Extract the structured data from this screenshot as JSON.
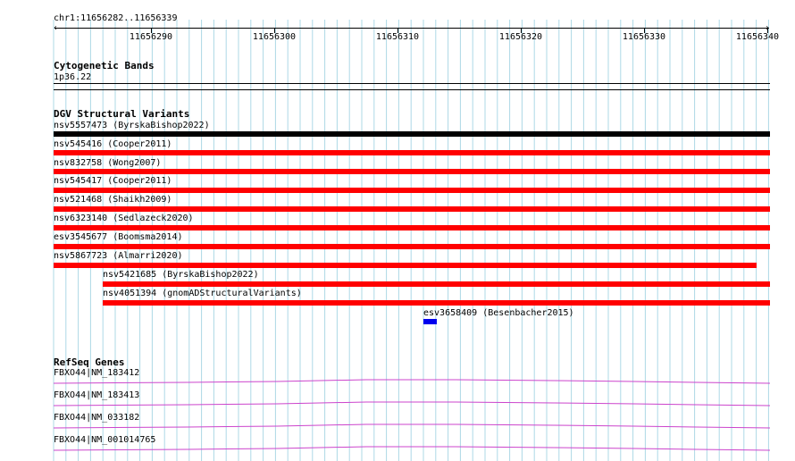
{
  "ruler": {
    "region_label": "chr1:11656282..11656339",
    "ticks": [
      "11656290",
      "11656300",
      "11656310",
      "11656320",
      "11656330",
      "11656340"
    ]
  },
  "tracks": {
    "cytobands": {
      "title": "Cytogenetic Bands",
      "band": "1p36.22"
    },
    "dgv": {
      "title": "DGV Structural Variants",
      "features": [
        {
          "label": "nsv5557473 (ByrskaBishop2022)",
          "color": "#000000"
        },
        {
          "label": "nsv545416 (Cooper2011)",
          "color": "#ff0000"
        },
        {
          "label": "nsv832758 (Wong2007)",
          "color": "#ff0000"
        },
        {
          "label": "nsv545417 (Cooper2011)",
          "color": "#ff0000"
        },
        {
          "label": "nsv521468 (Shaikh2009)",
          "color": "#ff0000"
        },
        {
          "label": "nsv6323140 (Sedlazeck2020)",
          "color": "#ff0000"
        },
        {
          "label": "esv3545677 (Boomsma2014)",
          "color": "#ff0000"
        },
        {
          "label": "nsv5867723 (Almarri2020)",
          "color": "#ff0000"
        },
        {
          "label": "nsv5421685 (ByrskaBishop2022)",
          "color": "#ff0000"
        },
        {
          "label": "nsv4051394 (gnomADStructuralVariants)",
          "color": "#ff0000"
        },
        {
          "label": "esv3658409 (Besenbacher2015)",
          "color": "#0000ee"
        }
      ]
    },
    "refseq": {
      "title": "RefSeq Genes",
      "line_color": "#cc44cc",
      "genes": [
        {
          "label": "FBXO44|NM_183412"
        },
        {
          "label": "FBXO44|NM_183413"
        },
        {
          "label": "FBXO44|NM_033182"
        },
        {
          "label": "FBXO44|NM_001014765"
        }
      ]
    }
  },
  "colors": {
    "grid_line": "#add8e6"
  }
}
